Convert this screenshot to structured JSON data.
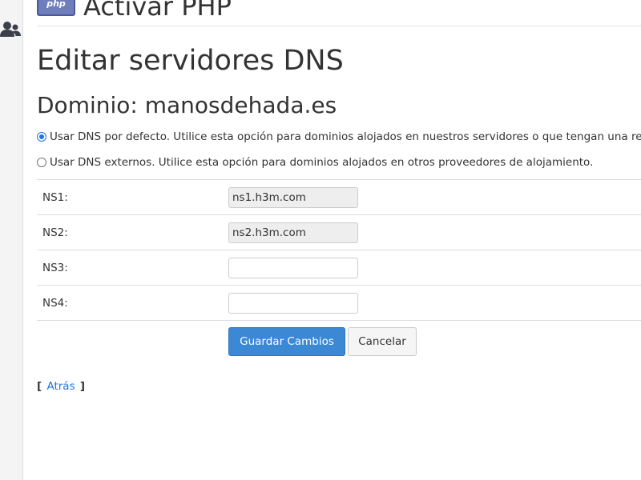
{
  "header": {
    "badge_text": "php",
    "title": "Activar PHP"
  },
  "sidebar": {
    "icon": "users-icon"
  },
  "page": {
    "title": "Editar servidores DNS",
    "domain_heading": "Dominio: manosdehada.es"
  },
  "dns_mode": {
    "default_label": "Usar DNS por defecto. Utilice esta opción para dominios alojados en nuestros servidores o que tengan una re",
    "default_selected": true,
    "external_label": "Usar DNS externos. Utilice esta opción para dominios alojados en otros proveedores de alojamiento.",
    "external_selected": false
  },
  "nameservers": [
    {
      "label": "NS1:",
      "value": "ns1.h3m.com"
    },
    {
      "label": "NS2:",
      "value": "ns2.h3m.com"
    },
    {
      "label": "NS3:",
      "value": ""
    },
    {
      "label": "NS4:",
      "value": ""
    }
  ],
  "actions": {
    "save_label": "Guardar Cambios",
    "cancel_label": "Cancelar"
  },
  "footer": {
    "bracket_open": "[",
    "back_label": "Atrás",
    "bracket_close": "]"
  },
  "colors": {
    "primary_button": "#3b88d4",
    "link": "#1a73e8",
    "text": "#333333"
  }
}
